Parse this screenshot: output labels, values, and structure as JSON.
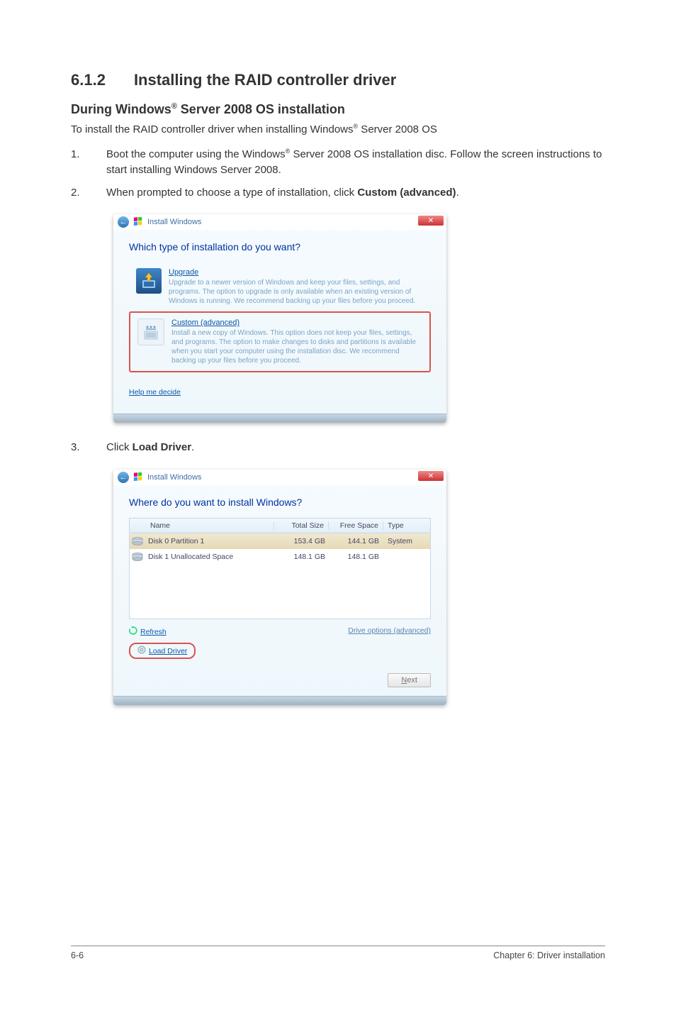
{
  "heading": {
    "number": "6.1.2",
    "title": "Installing the RAID controller driver"
  },
  "subheading": {
    "before_reg": "During Windows",
    "reg": "®",
    "after_reg": " Server 2008 OS installation"
  },
  "intro": {
    "before_reg": "To install the RAID controller driver when installing Windows",
    "reg": "®",
    "after_reg": " Server 2008 OS"
  },
  "steps": [
    {
      "num": "1.",
      "line1_a": "Boot the computer using the Windows",
      "line1_reg": "®",
      "line1_b": " Server 2008 OS installation disc. Follow the screen instructions to start installing Windows Server 2008."
    },
    {
      "num": "2.",
      "text_a": "When prompted to choose a type of installation, click ",
      "bold": "Custom (advanced)",
      "text_b": "."
    },
    {
      "num": "3.",
      "text_a": "Click ",
      "bold": "Load Driver",
      "text_b": "."
    }
  ],
  "screenshot1": {
    "window_title": "Install Windows",
    "close_glyph": "✕",
    "back_glyph": "←",
    "question": "Which type of installation do you want?",
    "upgrade": {
      "title": "Upgrade",
      "desc": "Upgrade to a newer version of Windows and keep your files, settings, and programs. The option to upgrade is only available when an existing version of Windows is running. We recommend backing up your files before you proceed."
    },
    "custom": {
      "title": "Custom (advanced)",
      "desc": "Install a new copy of Windows. This option does not keep your files, settings, and programs. The option to make changes to disks and partitions is available when you start your computer using the installation disc. We recommend backing up your files before you proceed."
    },
    "help": "Help me decide"
  },
  "screenshot2": {
    "window_title": "Install Windows",
    "close_glyph": "✕",
    "back_glyph": "←",
    "question": "Where do you want to install Windows?",
    "columns": {
      "name": "Name",
      "total": "Total Size",
      "free": "Free Space",
      "type": "Type"
    },
    "rows": [
      {
        "name": "Disk 0 Partition 1",
        "total": "153.4 GB",
        "free": "144.1 GB",
        "type": "System"
      },
      {
        "name": "Disk 1 Unallocated Space",
        "total": "148.1 GB",
        "free": "148.1 GB",
        "type": ""
      }
    ],
    "refresh": "Refresh",
    "load_driver": "Load Driver",
    "drive_options": "Drive options (advanced)",
    "next_underline": "N",
    "next_rest": "ext"
  },
  "footer": {
    "left": "6-6",
    "right": "Chapter 6: Driver installation"
  }
}
